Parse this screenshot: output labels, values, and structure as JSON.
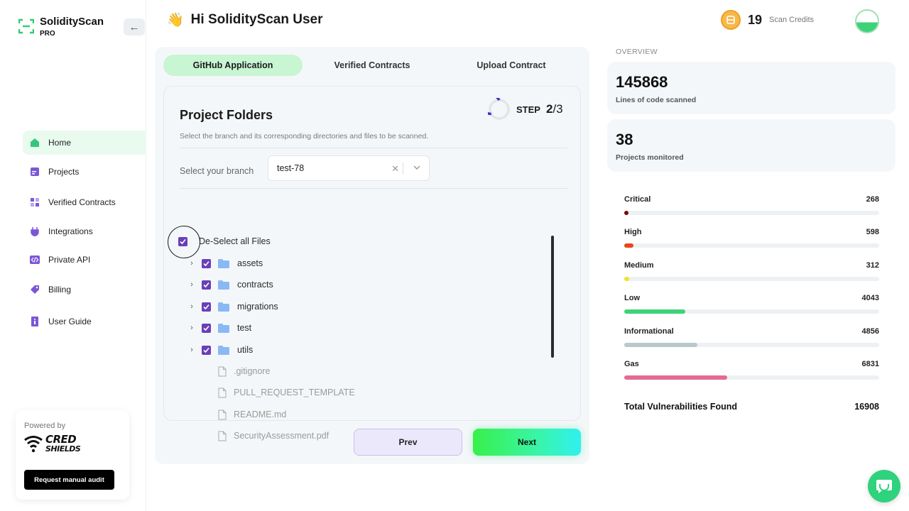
{
  "app": {
    "name": "SolidityScan",
    "tier": "PRO"
  },
  "sidebar": {
    "items": [
      {
        "label": "Home",
        "icon": "home-icon",
        "active": true
      },
      {
        "label": "Projects",
        "icon": "projects-icon"
      },
      {
        "label": "Verified Contracts",
        "icon": "grid-icon"
      },
      {
        "label": "Integrations",
        "icon": "plug-icon"
      },
      {
        "label": "Private API",
        "icon": "code-icon"
      },
      {
        "label": "Billing",
        "icon": "tag-icon"
      },
      {
        "label": "User Guide",
        "icon": "book-icon"
      }
    ],
    "powered_by": "Powered by",
    "partner_line1": "CRED",
    "partner_line2": "SHIELDS",
    "audit_button": "Request manual audit"
  },
  "header": {
    "wave": "👋",
    "greeting": "Hi SolidityScan User",
    "credits_value": "19",
    "credits_label": "Scan Credits"
  },
  "tabs": [
    {
      "label": "GitHub Application",
      "active": true
    },
    {
      "label": "Verified Contracts",
      "active": false
    },
    {
      "label": "Upload Contract",
      "active": false
    }
  ],
  "project": {
    "title": "Project Folders",
    "step_label": "STEP",
    "step_current": "2",
    "step_total": "/3",
    "subtitle": "Select the branch and its corresponding directories and files to be scanned.",
    "branch_label": "Select your branch",
    "branch_value": "test-78",
    "select_all_label": "De-Select all Files",
    "folders": [
      "assets",
      "contracts",
      "migrations",
      "test",
      "utils"
    ],
    "files": [
      ".gitignore",
      "PULL_REQUEST_TEMPLATE",
      "README.md",
      "SecurityAssessment.pdf"
    ],
    "prev": "Prev",
    "next": "Next"
  },
  "overview": {
    "label": "OVERVIEW",
    "lines_value": "145868",
    "lines_label": "Lines of code scanned",
    "projects_value": "38",
    "projects_label": "Projects monitored",
    "severities": [
      {
        "name": "Critical",
        "count": "268",
        "fill": 0.016,
        "color": "#7a0a0a"
      },
      {
        "name": "High",
        "count": "598",
        "fill": 0.036,
        "color": "#e8471c"
      },
      {
        "name": "Medium",
        "count": "312",
        "fill": 0.019,
        "color": "#f2e229"
      },
      {
        "name": "Low",
        "count": "4043",
        "fill": 0.24,
        "color": "#3ed27a"
      },
      {
        "name": "Informational",
        "count": "4856",
        "fill": 0.288,
        "color": "#b8c8cc"
      },
      {
        "name": "Gas",
        "count": "6831",
        "fill": 0.405,
        "color": "#e56a95"
      }
    ],
    "total_label": "Total Vulnerabilities Found",
    "total_value": "16908"
  }
}
